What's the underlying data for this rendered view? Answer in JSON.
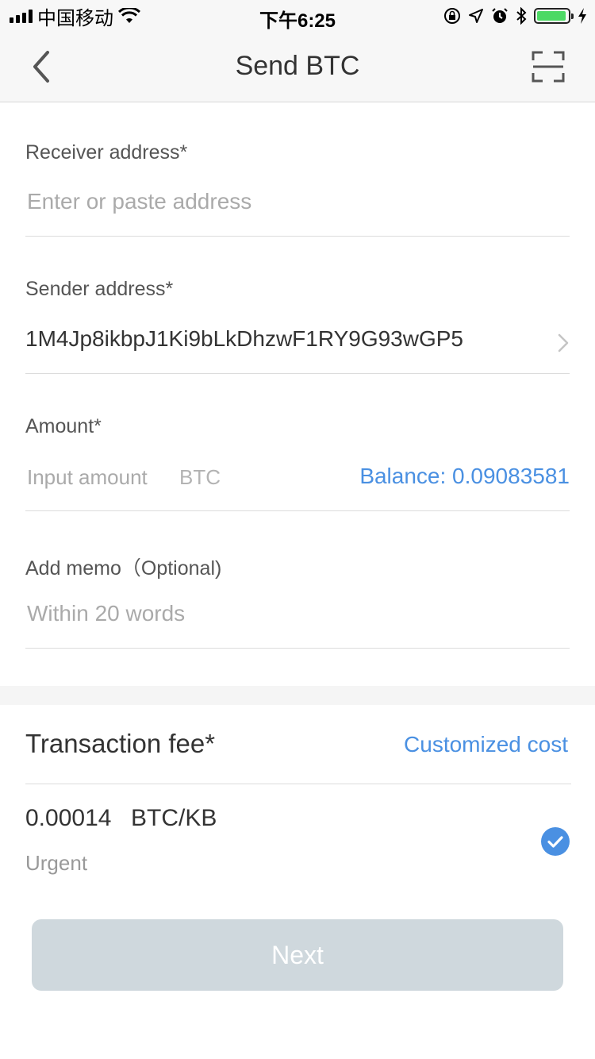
{
  "status_bar": {
    "carrier": "中国移动",
    "time": "下午6:25",
    "battery_level": 0.95,
    "battery_color": "#4cd964",
    "icons": [
      "signal-icon",
      "wifi-icon",
      "orientation-lock-icon",
      "location-icon",
      "alarm-icon",
      "bluetooth-icon",
      "battery-icon",
      "charging-icon"
    ]
  },
  "nav": {
    "title": "Send BTC",
    "back_icon": "chevron-left-icon",
    "scan_icon": "scan-icon"
  },
  "form": {
    "receiver": {
      "label": "Receiver address*",
      "placeholder": "Enter or paste address"
    },
    "sender": {
      "label": "Sender address*",
      "value": "1M4Jp8ikbpJ1Ki9bLkDhzwF1RY9G93wGP5",
      "icon": "chevron-right-icon"
    },
    "amount": {
      "label": "Amount*",
      "placeholder": "Input amount",
      "unit": "BTC",
      "balance": "Balance: 0.09083581"
    },
    "memo": {
      "label": "Add memo（Optional)",
      "placeholder": "Within 20 words"
    }
  },
  "fee": {
    "title": "Transaction fee*",
    "custom_link": "Customized cost",
    "rate": "0.00014",
    "unit": "BTC/KB",
    "speed": "Urgent",
    "selected_icon": "checkmark-icon"
  },
  "next_button": "Next",
  "colors": {
    "accent": "#4a90e2",
    "button_disabled": "#cfd8dd",
    "nav_bg": "#f7f7f7"
  }
}
